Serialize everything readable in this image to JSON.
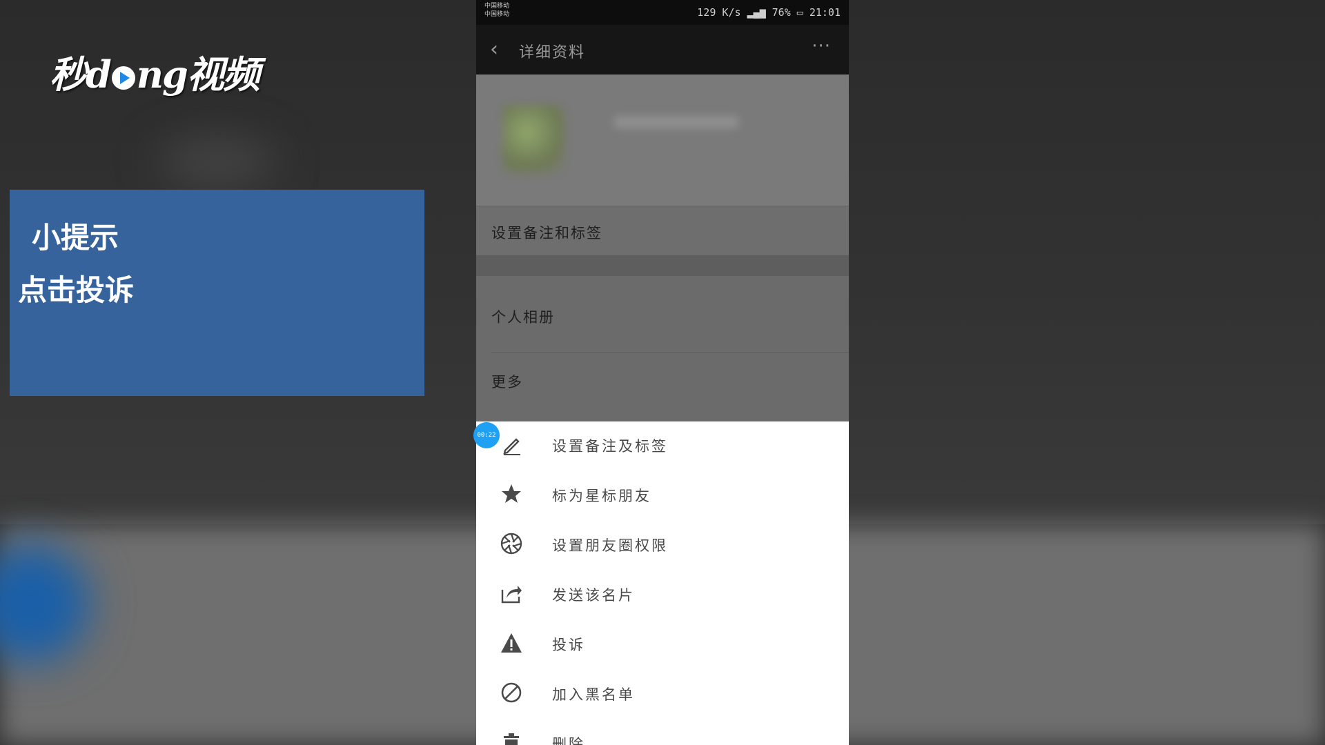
{
  "logo": {
    "text_left": "秒d",
    "text_right": "ng视频"
  },
  "tip": {
    "title": "小提示",
    "text": "点击投诉"
  },
  "status_bar": {
    "carrier_1": "中国移动",
    "carrier_2": "中国移动",
    "speed": "129 K/s",
    "battery": "76%",
    "time": "21:01"
  },
  "nav": {
    "title": "详细资料",
    "more": "···"
  },
  "rows": {
    "remark": "设置备注和标签",
    "album": "个人相册",
    "more": "更多"
  },
  "timer": "00:22",
  "menu": [
    {
      "label": "设置备注及标签",
      "icon": "pencil-icon"
    },
    {
      "label": "标为星标朋友",
      "icon": "star-icon"
    },
    {
      "label": "设置朋友圈权限",
      "icon": "aperture-icon"
    },
    {
      "label": "发送该名片",
      "icon": "share-icon"
    },
    {
      "label": "投诉",
      "icon": "warning-icon"
    },
    {
      "label": "加入黑名单",
      "icon": "block-icon"
    },
    {
      "label": "删除",
      "icon": "trash-icon"
    }
  ],
  "colors": {
    "tip_bg": "#36639c",
    "timer": "#1ea1f5"
  }
}
